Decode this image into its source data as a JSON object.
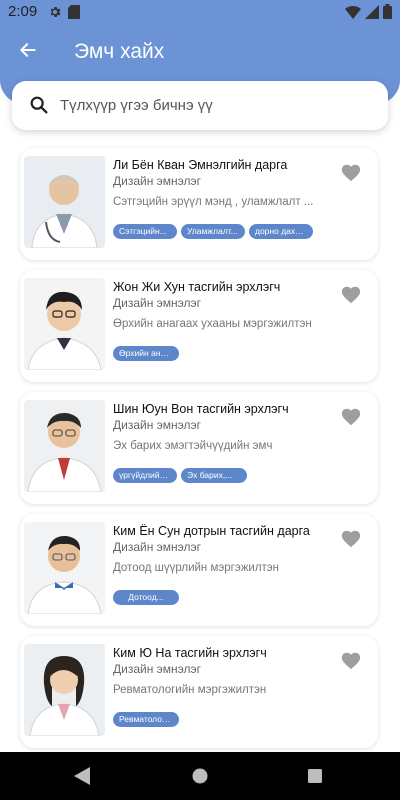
{
  "status_bar": {
    "time": "2:09",
    "icons": [
      "gear-icon",
      "sd-card-icon",
      "wifi-icon",
      "signal-icon",
      "battery-icon"
    ]
  },
  "header": {
    "title": "Эмч хайх",
    "back_icon": "arrow-left-icon"
  },
  "search": {
    "placeholder": "Түлхүүр үгээ бичнэ үү",
    "value": ""
  },
  "doctors": [
    {
      "name": "Ли Бён Кван Эмнэлгийн дарга",
      "title": "Дизайн эмнэлэг",
      "description": "Сэтгэцийн эрүүл мэнд , уламжлалт ...",
      "tags": [
        "Сэтгэцийн...",
        "Уламжлалт...",
        "дорно дахины..."
      ],
      "favorite": false
    },
    {
      "name": "Жон Жи Хун тасгийн эрхлэгч",
      "title": "Дизайн эмнэлэг",
      "description": "Өрхийн анагаах ухааны мэргэжилтэн",
      "tags": [
        "Өрхийн анагаа..."
      ],
      "favorite": false
    },
    {
      "name": "Шин Юун Вон тасгийн эрхлэгч",
      "title": "Дизайн эмнэлэг",
      "description": "Эх барих эмэгтэйчүүдийн эмч",
      "tags": [
        "үргүйдлийн төв",
        "Эх барих,..."
      ],
      "favorite": false
    },
    {
      "name": "Ким Ён Сун дотрын тасгийн дарга",
      "title": "Дизайн эмнэлэг",
      "description": "Дотоод шүүрлийн мэргэжилтэн",
      "tags": [
        "Дотоод..."
      ],
      "favorite": false
    },
    {
      "name": "Ким Ю На тасгийн эрхлэгч",
      "title": "Дизайн эмнэлэг",
      "description": "Ревматологийн мэргэжилтэн",
      "tags": [
        "Ревматологий..."
      ],
      "favorite": false
    }
  ],
  "colors": {
    "primary": "#6b93d6",
    "tag": "#5e87cb",
    "heart": "#9e9e9e"
  },
  "nav": {
    "icons": [
      "nav-back-icon",
      "nav-home-icon",
      "nav-recent-apps-icon"
    ]
  }
}
